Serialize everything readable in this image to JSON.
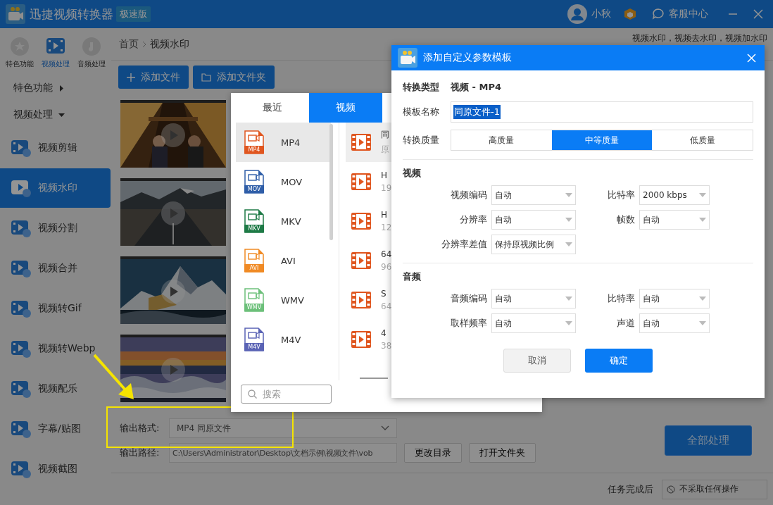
{
  "app": {
    "title": "迅捷视频转换器",
    "edition": "极速版",
    "user": "小秋",
    "support": "客服中心"
  },
  "top_tabs": [
    {
      "label": "特色功能",
      "selected": false
    },
    {
      "label": "视频处理",
      "selected": true
    },
    {
      "label": "音频处理",
      "selected": false
    }
  ],
  "sidebar": {
    "groups": [
      {
        "label": "特色功能",
        "expanded": false
      },
      {
        "label": "视频处理",
        "expanded": true
      }
    ],
    "items": [
      {
        "label": "视频剪辑",
        "selected": false
      },
      {
        "label": "视频水印",
        "selected": true
      },
      {
        "label": "视频分割",
        "selected": false
      },
      {
        "label": "视频合并",
        "selected": false
      },
      {
        "label": "视频转Gif",
        "selected": false
      },
      {
        "label": "视频转Webp",
        "selected": false
      },
      {
        "label": "视频配乐",
        "selected": false
      },
      {
        "label": "字幕/贴图",
        "selected": false
      },
      {
        "label": "视频截图",
        "selected": false
      }
    ]
  },
  "breadcrumb": [
    "首页",
    "视频水印"
  ],
  "header_note": "视频水印，视频去水印，视频加水印",
  "toolbar": [
    "添加文件",
    "添加文件夹"
  ],
  "videos": [
    {
      "kind": "picture"
    },
    {
      "kind": "picture"
    },
    {
      "kind": "picture"
    },
    {
      "kind": "picture"
    }
  ],
  "output": {
    "format_label": "输出格式:",
    "format_value": "MP4  同原文件",
    "path_label": "输出路径:",
    "path_value": "C:\\Users\\Administrator\\Desktop\\文档示例\\视频文件\\vob",
    "change_dir": "更改目录",
    "open_folder": "打开文件夹",
    "process_all": "全部处理",
    "after_label": "任务完成后",
    "after_value": "不采取任何操作"
  },
  "format_popup": {
    "tabs": [
      {
        "label": "最近",
        "selected": false
      },
      {
        "label": "视频",
        "selected": true
      }
    ],
    "formats": [
      {
        "name": "MP4",
        "badge": "MP4",
        "color": "#e0561f",
        "selected": true
      },
      {
        "name": "MOV",
        "badge": "MOV",
        "color": "#2f5ea8",
        "selected": false
      },
      {
        "name": "MKV",
        "badge": "MKV",
        "color": "#1e7a46",
        "selected": false
      },
      {
        "name": "AVI",
        "badge": "AVI",
        "color": "#f08a24",
        "selected": false
      },
      {
        "name": "WMV",
        "badge": "WMV",
        "color": "#6cc07a",
        "selected": false
      },
      {
        "name": "M4V",
        "badge": "M4V",
        "color": "#5a63b5",
        "selected": false
      }
    ],
    "presets": [
      {
        "title": "同",
        "detail": "原",
        "selected": true
      },
      {
        "title": "H",
        "detail": "19",
        "selected": false
      },
      {
        "title": "H",
        "detail": "12",
        "selected": false
      },
      {
        "title": "64",
        "detail": "96",
        "selected": false
      },
      {
        "title": "S",
        "detail": "64",
        "selected": false
      },
      {
        "title": "4",
        "detail": "38",
        "selected": false
      }
    ],
    "search_placeholder": "搜索"
  },
  "dialog": {
    "title": "添加自定义参数模板",
    "type_label": "转换类型",
    "type_value": "视频 - MP4",
    "name_label": "模板名称",
    "name_value": "同原文件-1",
    "quality_label": "转换质量",
    "quality": [
      {
        "label": "高质量",
        "selected": false
      },
      {
        "label": "中等质量",
        "selected": true
      },
      {
        "label": "低质量",
        "selected": false
      }
    ],
    "sections": [
      {
        "title": "视频",
        "fields": [
          {
            "label": "视频编码",
            "value": "自动"
          },
          {
            "label": "比特率",
            "value": "2000 kbps"
          },
          {
            "label": "分辨率",
            "value": "自动"
          },
          {
            "label": "帧数",
            "value": "自动"
          },
          {
            "label": "分辨率差值",
            "value": "保持原视频比例"
          }
        ]
      },
      {
        "title": "音频",
        "fields": [
          {
            "label": "音频编码",
            "value": "自动"
          },
          {
            "label": "比特率",
            "value": "自动"
          },
          {
            "label": "取样频率",
            "value": "自动"
          },
          {
            "label": "声道",
            "value": "自动"
          }
        ]
      }
    ],
    "cancel": "取消",
    "ok": "确定"
  }
}
